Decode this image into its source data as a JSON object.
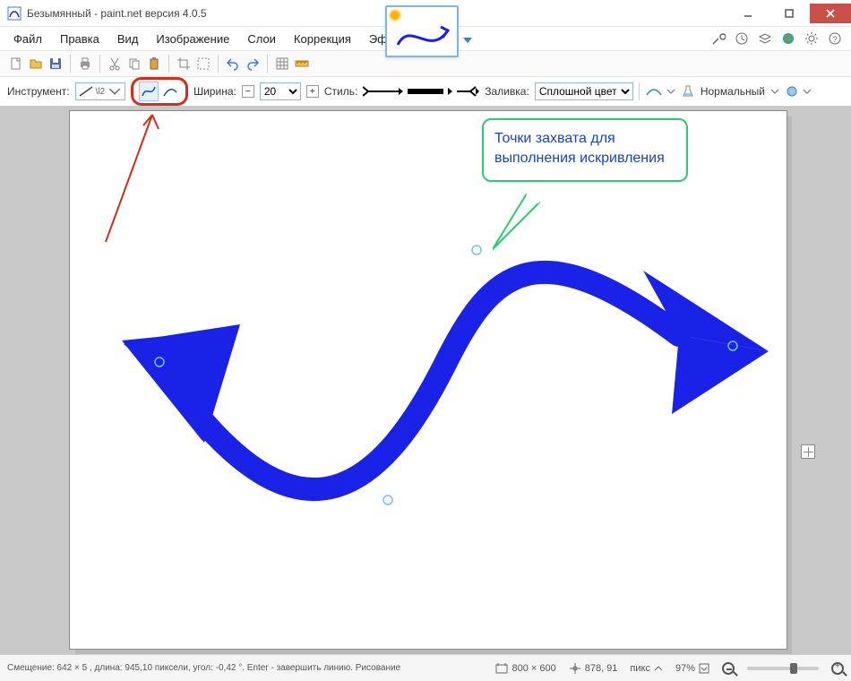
{
  "titlebar": {
    "title": "Безымянный - paint.net версия 4.0.5"
  },
  "menu": {
    "file": "Файл",
    "edit": "Правка",
    "view": "Вид",
    "image": "Изображение",
    "layers": "Слои",
    "adjustments": "Коррекция",
    "effects": "Эффекты"
  },
  "toolbar2": {
    "tool_label": "Инструмент:",
    "tool_value": "\\l2",
    "width_label": "Ширина:",
    "width_value": "20",
    "style_label": "Стиль:",
    "fill_label": "Заливка:",
    "fill_value": "Сплошной цвет",
    "blend_label": "Нормальный"
  },
  "annotations": {
    "callout": "Точки захвата для выполнения искривления"
  },
  "status": {
    "hint": "Смещение: 642  × 5 , длина: 945,10 пиксели, угол: -0,42 °. Enter - завершить линию. Рисование в другом месте создаст новую.",
    "canvas_size": "800 × 600",
    "cursor_pos": "878, 91",
    "unit": "пикс",
    "zoom": "97%"
  },
  "colors": {
    "curve_stroke": "#1b22e8",
    "anno_red": "#d62c1a",
    "callout_border": "#2dc96f",
    "callout_text": "#1942c4"
  }
}
